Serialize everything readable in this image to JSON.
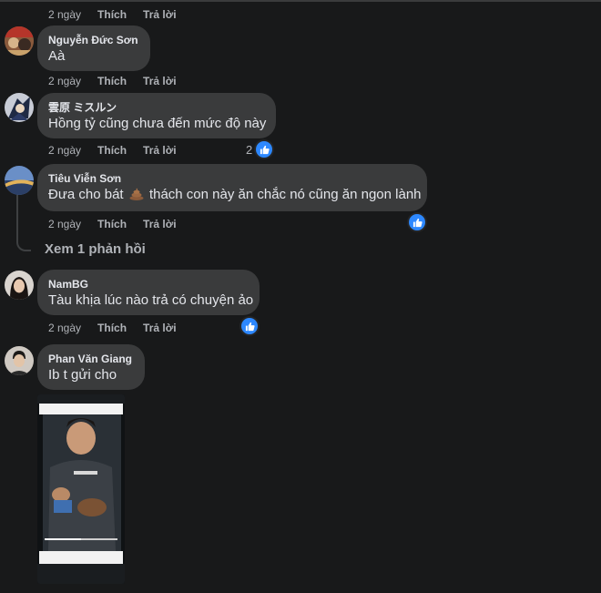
{
  "actions": {
    "time": "2 ngày",
    "like": "Thích",
    "reply": "Trả lời"
  },
  "comments": [
    {
      "author": "Nguyễn Đức Sơn",
      "text": "Aà"
    },
    {
      "author": "雲原 ミスルン",
      "text": "Hồng tỷ cũng chưa đến mức độ này",
      "like_count": "2"
    },
    {
      "author": "Tiêu Viễn Sơn",
      "text_before": "Đưa cho bát",
      "text_after": "thách con này ăn chắc nó cũng ăn ngon lành",
      "emoji": "poop-emoji",
      "replies": "Xem 1 phản hồi"
    },
    {
      "author": "NamBG",
      "text": "Tàu khịa lúc nào trả có chuyện ảo"
    },
    {
      "author": "Phan Văn Giang",
      "text": "Ib t gửi cho",
      "attachment": "video-screenshot-image"
    }
  ],
  "colors": {
    "background": "#18191a",
    "bubble": "#3a3b3c",
    "meta": "#b0b3b8",
    "like_blue": "#2d88ff"
  }
}
